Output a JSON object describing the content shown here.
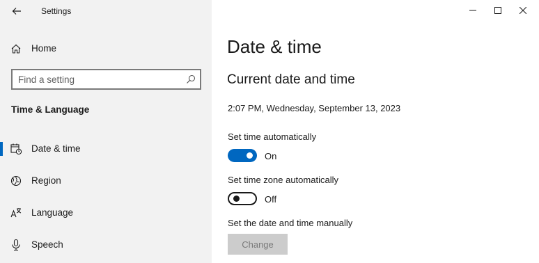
{
  "window": {
    "title": "Settings",
    "controls": [
      "minimize-icon",
      "maximize-icon",
      "close-icon"
    ]
  },
  "sidebar": {
    "home_label": "Home",
    "search": {
      "placeholder": "Find a setting",
      "value": ""
    },
    "section_heading": "Time & Language",
    "items": [
      {
        "label": "Date & time",
        "icon": "calendar-clock-icon",
        "selected": true
      },
      {
        "label": "Region",
        "icon": "globe-icon",
        "selected": false
      },
      {
        "label": "Language",
        "icon": "language-icon",
        "selected": false
      },
      {
        "label": "Speech",
        "icon": "microphone-icon",
        "selected": false
      }
    ]
  },
  "main": {
    "title": "Date & time",
    "subtitle": "Current date and time",
    "current_datetime": "2:07 PM, Wednesday, September 13, 2023",
    "settings": {
      "auto_time": {
        "label": "Set time automatically",
        "state": "On",
        "enabled": true
      },
      "auto_timezone": {
        "label": "Set time zone automatically",
        "state": "Off",
        "enabled": false
      },
      "manual": {
        "label": "Set the date and time manually",
        "button_label": "Change",
        "button_disabled": true
      }
    }
  },
  "colors": {
    "accent": "#0067c0",
    "sidebar_bg": "#f2f2f2",
    "disabled_button_bg": "#cccccc"
  }
}
